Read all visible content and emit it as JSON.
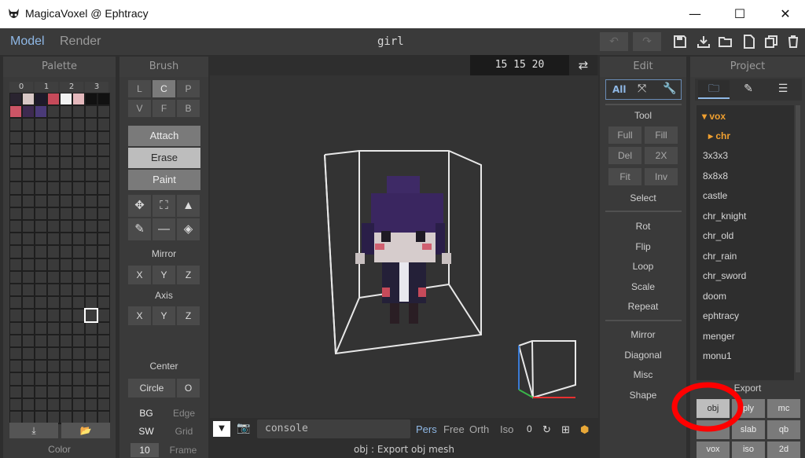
{
  "window": {
    "title": "MagicaVoxel @ Ephtracy"
  },
  "topbar": {
    "model_tab": "Model",
    "render_tab": "Render",
    "filename": "girl",
    "undo": "↶",
    "redo": "↷"
  },
  "palette": {
    "header": "Palette",
    "tabs": [
      "0",
      "1",
      "2",
      "3"
    ],
    "footer": "Color",
    "colors": [
      "#2a2430",
      "#d8c8c6",
      "#1e1a2a",
      "#c64a5a",
      "#f2f2f2",
      "#e4b8bc",
      "#cc5566",
      "#3d2a50",
      "#4a3a78"
    ]
  },
  "brush": {
    "header": "Brush",
    "shapes": [
      "L",
      "C",
      "P",
      "V",
      "F",
      "B"
    ],
    "attach": "Attach",
    "erase": "Erase",
    "paint": "Paint",
    "mirror": "Mirror",
    "axis": "Axis",
    "axes": [
      "X",
      "Y",
      "Z"
    ],
    "center": "Center",
    "circle": "Circle",
    "circle_o": "O",
    "bg": "BG",
    "edge": "Edge",
    "sw": "SW",
    "grid": "Grid",
    "frame_num": "10",
    "frame": "Frame"
  },
  "viewport": {
    "coords": "15 15 20",
    "console_placeholder": "console",
    "modes": [
      "Pers",
      "Free",
      "Orth",
      "Iso"
    ],
    "num": "0",
    "status": "obj : Export obj mesh"
  },
  "edit": {
    "header": "Edit",
    "all": "All",
    "tool": "Tool",
    "tool_buttons": [
      "Full",
      "Fill",
      "Del",
      "2X",
      "Fit",
      "Inv"
    ],
    "select": "Select",
    "ops": [
      "Rot",
      "Flip",
      "Loop",
      "Scale",
      "Repeat"
    ],
    "ops2": [
      "Mirror",
      "Diagonal",
      "Misc",
      "Shape"
    ]
  },
  "project": {
    "header": "Project",
    "folder": "vox",
    "subfolder": "chr",
    "items": [
      "3x3x3",
      "8x8x8",
      "castle",
      "chr_knight",
      "chr_old",
      "chr_rain",
      "chr_sword",
      "doom",
      "ephtracy",
      "menger",
      "monu1"
    ],
    "export": "Export",
    "export_buttons": [
      "obj",
      "ply",
      "mc",
      "slab",
      "qb",
      "vox",
      "iso",
      "2d"
    ]
  },
  "colors": {
    "accent": "#8fb8e6",
    "highlight": "#ff0000"
  }
}
